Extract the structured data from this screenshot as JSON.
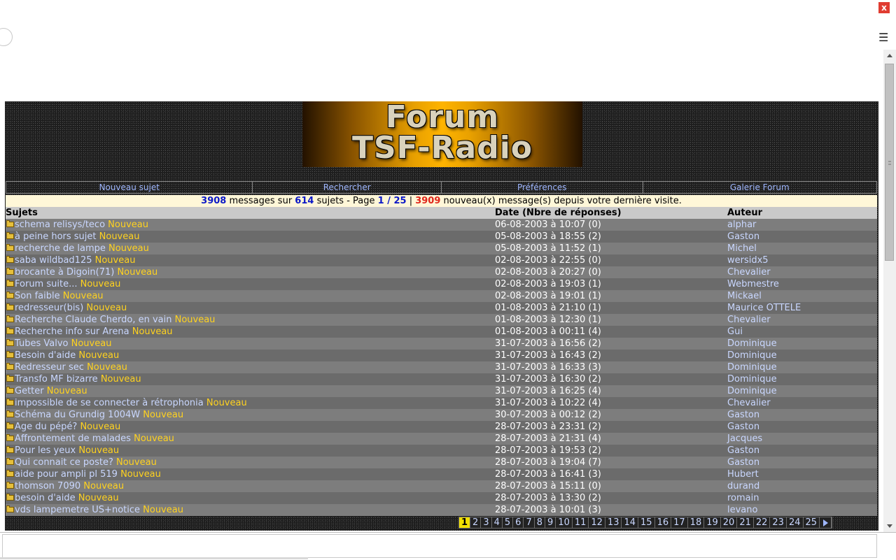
{
  "browser": {
    "close_glyph": "x",
    "menu_glyph": "☰"
  },
  "logo": {
    "line1": "Forum",
    "line2": "TSF-Radio"
  },
  "nav": [
    {
      "label": "Nouveau sujet"
    },
    {
      "label": "Rechercher"
    },
    {
      "label": "Préférences"
    },
    {
      "label": "Galerie Forum"
    }
  ],
  "info": {
    "messages": "3908",
    "t1": " messages sur ",
    "topics": "614",
    "t2": " sujets - Page ",
    "page": "1 / 25",
    "t3": " | ",
    "new_count": "3909",
    "t4": " nouveau(x) message(s) depuis votre dernière visite."
  },
  "table": {
    "headers": {
      "subject": "Sujets",
      "date": "Date (Nbre de réponses)",
      "author": "Auteur"
    },
    "new_label": "Nouveau",
    "rows": [
      {
        "subject": "schema relisys/teco",
        "date": "06-08-2003 à 10:07 (0)",
        "author": "alphar"
      },
      {
        "subject": "à peine hors sujet",
        "date": "05-08-2003 à 18:55 (2)",
        "author": "Gaston"
      },
      {
        "subject": "recherche de lampe",
        "date": "05-08-2003 à 11:52 (1)",
        "author": "Michel"
      },
      {
        "subject": "saba wildbad125",
        "date": "02-08-2003 à 22:55 (0)",
        "author": "wersidx5"
      },
      {
        "subject": "brocante à Digoin(71)",
        "date": "02-08-2003 à 20:27 (0)",
        "author": "Chevalier"
      },
      {
        "subject": "Forum suite...",
        "date": "02-08-2003 à 19:03 (1)",
        "author": "Webmestre"
      },
      {
        "subject": "Son faible",
        "date": "02-08-2003 à 19:01 (1)",
        "author": "Mickael"
      },
      {
        "subject": "redresseur(bis)",
        "date": "01-08-2003 à 21:10 (1)",
        "author": "Maurice OTTELE"
      },
      {
        "subject": "Recherche Claude Cherdo, en vain",
        "date": "01-08-2003 à 12:30 (1)",
        "author": "Chevalier"
      },
      {
        "subject": "Recherche info sur Arena",
        "date": "01-08-2003 à 00:11 (4)",
        "author": "Gui"
      },
      {
        "subject": "Tubes Valvo",
        "date": "31-07-2003 à 16:56 (2)",
        "author": "Dominique"
      },
      {
        "subject": "Besoin d'aide",
        "date": "31-07-2003 à 16:43 (2)",
        "author": "Dominique"
      },
      {
        "subject": "Redresseur sec",
        "date": "31-07-2003 à 16:33 (3)",
        "author": "Dominique"
      },
      {
        "subject": "Transfo MF bizarre",
        "date": "31-07-2003 à 16:30 (2)",
        "author": "Dominique"
      },
      {
        "subject": "Getter",
        "date": "31-07-2003 à 16:25 (4)",
        "author": "Dominique"
      },
      {
        "subject": "impossible de se connecter à rétrophonia",
        "date": "31-07-2003 à 10:22 (4)",
        "author": "Chevalier"
      },
      {
        "subject": "Schéma du Grundig 1004W",
        "date": "30-07-2003 à 00:12 (2)",
        "author": "Gaston"
      },
      {
        "subject": "Age du pépé?",
        "date": "28-07-2003 à 23:31 (2)",
        "author": "Gaston"
      },
      {
        "subject": "Affrontement de malades",
        "date": "28-07-2003 à 21:31 (4)",
        "author": "Jacques"
      },
      {
        "subject": "Pour les yeux",
        "date": "28-07-2003 à 19:53 (2)",
        "author": "Gaston"
      },
      {
        "subject": "Qui connait ce poste?",
        "date": "28-07-2003 à 19:04 (7)",
        "author": "Gaston"
      },
      {
        "subject": " aide pour ampli pl 519",
        "date": "28-07-2003 à 16:41 (3)",
        "author": "Hubert"
      },
      {
        "subject": "thomson 7090",
        "date": "28-07-2003 à 15:11 (0)",
        "author": "durand"
      },
      {
        "subject": "besoin d'aide",
        "date": "28-07-2003 à 13:30 (2)",
        "author": "romain"
      },
      {
        "subject": "vds lampemetre US+notice",
        "date": "28-07-2003 à 10:01 (3)",
        "author": "levano"
      }
    ]
  },
  "pagination": {
    "current": "1",
    "pages": [
      "1",
      "2",
      "3",
      "4",
      "5",
      "6",
      "7",
      "8",
      "9",
      "10",
      "11",
      "12",
      "13",
      "14",
      "15",
      "16",
      "17",
      "18",
      "19",
      "20",
      "21",
      "22",
      "23",
      "24",
      "25"
    ]
  },
  "colors": {
    "link": "#c9d7ff",
    "new_badge": "#ffd21f",
    "count_blue": "#0b18c7",
    "count_red": "#e0261b",
    "info_bg": "#fff7d8"
  }
}
